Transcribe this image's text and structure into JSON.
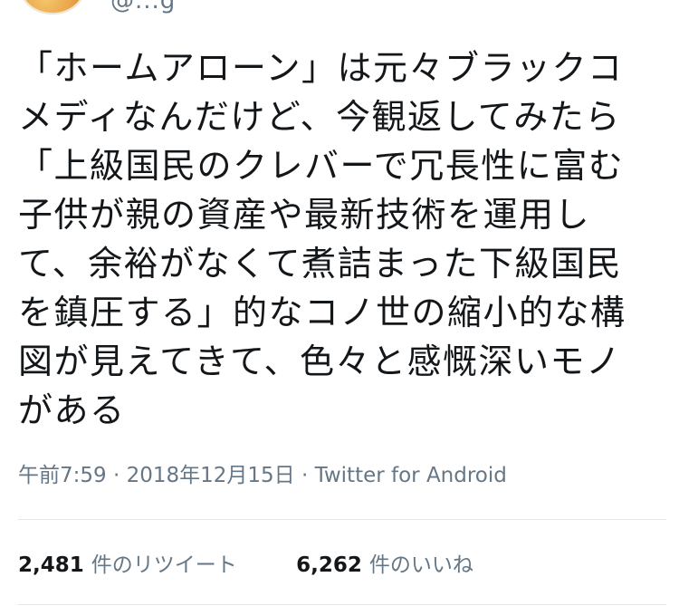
{
  "user": {
    "handle": "@...g"
  },
  "tweet": {
    "lines": [
      "「ホームアローン」は元々ブラックコ",
      "メディなんだけど、今観返してみたら",
      "「上級国民のクレバーで冗長性に富む",
      "子供が親の資産や最新技術を運用し",
      "て、余裕がなくて煮詰まった下級国民",
      "を鎮圧する」的なコノ世の縮小的な構",
      "図が見えてきて、色々と感慨深いモノ",
      "がある"
    ]
  },
  "meta": {
    "time": "午前7:59",
    "separator": "·",
    "date": "2018年12月15日",
    "client": "Twitter for Android"
  },
  "stats": {
    "retweets_count": "2,481",
    "retweets_label": "件のリツイート",
    "likes_count": "6,262",
    "likes_label": "件のいいね"
  }
}
